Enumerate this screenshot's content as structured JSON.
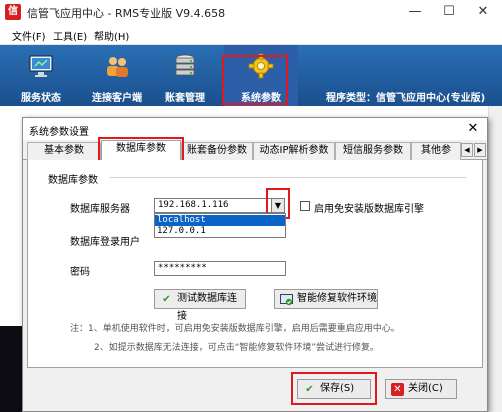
{
  "main_window": {
    "title": "信管飞应用中心 - RMS专业版 V9.4.658",
    "app_icon_glyph": "信",
    "minimize_glyph": "—",
    "maximize_glyph": "☐",
    "close_glyph": "✕"
  },
  "menubar": {
    "items": [
      {
        "label": "文件(F)"
      },
      {
        "label": "工具(E)"
      },
      {
        "label": "帮助(H)"
      }
    ]
  },
  "toolbar": {
    "items": [
      {
        "label": "服务状态",
        "icon": "monitor-icon"
      },
      {
        "label": "连接客户端",
        "icon": "users-icon"
      },
      {
        "label": "账套管理",
        "icon": "database-icon"
      },
      {
        "label": "系统参数",
        "icon": "gear-icon",
        "active": true
      }
    ],
    "program_type": "程序类型：信管飞应用中心(专业版)"
  },
  "dialog": {
    "title": "系统参数设置",
    "close_glyph": "✕",
    "tabs": [
      {
        "label": "基本参数"
      },
      {
        "label": "数据库参数",
        "active": true
      },
      {
        "label": "账套备份参数"
      },
      {
        "label": "动态IP解析参数"
      },
      {
        "label": "短信服务参数"
      },
      {
        "label": "其他参"
      }
    ],
    "tab_scroll_left": "◀",
    "tab_scroll_right": "▶",
    "section_title": "数据库参数",
    "fields": {
      "server_label": "数据库服务器",
      "server_value": "192.168.1.116",
      "dropdown_glyph": "▼",
      "dropdown_options": [
        {
          "label": "localhost",
          "selected": true
        },
        {
          "label": "127.0.0.1",
          "selected": false
        }
      ],
      "free_install_label": "启用免安装版数据库引擎",
      "login_user_label": "数据库登录用户",
      "password_label": "密码",
      "password_value": "*********"
    },
    "buttons": {
      "test_connection": "测试数据库连接",
      "repair_env": "智能修复软件环境",
      "save": "保存(S)",
      "close": "关闭(C)"
    },
    "notes": [
      "注：1、单机使用软件时，可启用免安装版数据库引擎，启用后需要重启应用中心。",
      "2、如提示数据库无法连接，可点击“智能修复软件环境”尝试进行修复。"
    ]
  }
}
